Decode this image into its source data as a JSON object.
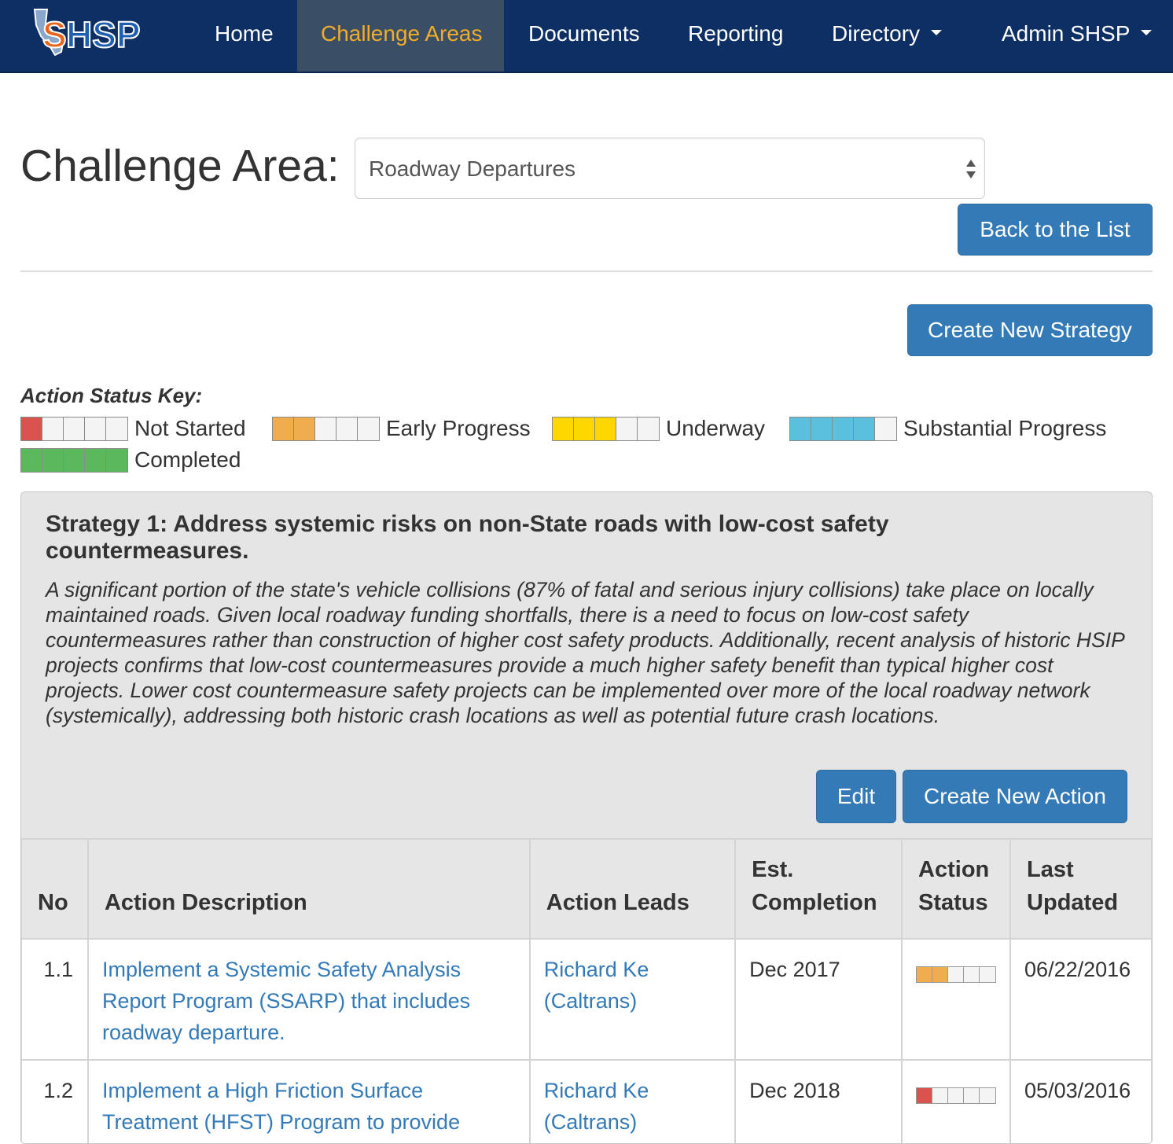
{
  "nav": {
    "logo_text": "SHSP",
    "items": [
      {
        "label": "Home"
      },
      {
        "label": "Challenge Areas"
      },
      {
        "label": "Documents"
      },
      {
        "label": "Reporting"
      },
      {
        "label": "Directory"
      },
      {
        "label": "Admin SHSP"
      }
    ]
  },
  "header": {
    "title": "Challenge Area:",
    "select_value": "Roadway Departures",
    "back_button": "Back to the List",
    "create_strategy_button": "Create New Strategy"
  },
  "status_key": {
    "title": "Action Status Key:",
    "items": [
      {
        "label": "Not Started",
        "filled": 1,
        "color": "#d9534f"
      },
      {
        "label": "Early Progress",
        "filled": 2,
        "color": "#f0ad4e"
      },
      {
        "label": "Underway",
        "filled": 3,
        "color": "#ffd700"
      },
      {
        "label": "Substantial Progress",
        "filled": 4,
        "color": "#5bc0de"
      },
      {
        "label": "Completed",
        "filled": 5,
        "color": "#5cb85c"
      }
    ]
  },
  "strategy": {
    "title": "Strategy 1: Address systemic risks on non-State roads with low-cost safety countermeasures.",
    "description": "A significant portion of the state's vehicle collisions (87% of fatal and serious injury collisions) take place on locally maintained roads. Given local roadway funding shortfalls, there is a need to focus on low-cost safety countermeasures rather than construction of higher cost safety products. Additionally, recent analysis of historic HSIP projects confirms that low-cost countermeasures provide a much higher safety benefit than typical higher cost projects. Lower cost countermeasure safety projects can be implemented over more of the local roadway network (systemically), addressing both historic crash locations as well as potential future crash locations.",
    "edit_button": "Edit",
    "create_action_button": "Create New Action"
  },
  "table": {
    "headers": {
      "no": "No",
      "description": "Action Description",
      "leads": "Action Leads",
      "completion": "Est. Completion",
      "status": "Action Status",
      "updated": "Last Updated"
    },
    "rows": [
      {
        "no": "1.1",
        "description": "Implement a Systemic Safety Analysis Report Program (SSARP) that includes roadway departure.",
        "leads": "Richard Ke (Caltrans)",
        "completion": "Dec 2017",
        "status_filled": 2,
        "status_color": "#f0ad4e",
        "updated": "06/22/2016"
      },
      {
        "no": "1.2",
        "description": "Implement a High Friction Surface Treatment (HFST) Program to provide",
        "leads": "Richard Ke (Caltrans)",
        "completion": "Dec 2018",
        "status_filled": 1,
        "status_color": "#d9534f",
        "updated": "05/03/2016"
      }
    ]
  }
}
